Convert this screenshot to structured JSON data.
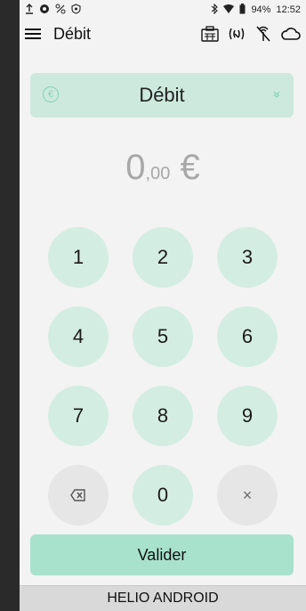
{
  "status_bar": {
    "battery": "94%",
    "time": "12:52",
    "left_icons": [
      "upload-icon",
      "data-icon",
      "percent-icon",
      "shield-icon"
    ],
    "right_icons": [
      "bluetooth-icon",
      "wifi-icon",
      "battery-icon"
    ]
  },
  "app_bar": {
    "title": "Débit",
    "icons": [
      "payment-terminal-icon",
      "nfc-icon",
      "no-antenna-icon",
      "cloud-icon"
    ]
  },
  "transaction_select": {
    "selected": "Débit",
    "icon": "euro-icon"
  },
  "amount": {
    "whole": "0",
    "cents": ",00",
    "currency": "€"
  },
  "keypad": {
    "rows": [
      [
        "1",
        "2",
        "3"
      ],
      [
        "4",
        "5",
        "6"
      ],
      [
        "7",
        "8",
        "9"
      ],
      [
        "backspace",
        "0",
        "×"
      ]
    ]
  },
  "actions": {
    "validate": "Valider"
  },
  "footer": {
    "label": "HELIO ANDROID"
  },
  "colors": {
    "key_bg": "#d4ede3",
    "select_bg": "#cde9de",
    "accent": "#84d2b4",
    "validate_bg": "#a8e2cd"
  }
}
